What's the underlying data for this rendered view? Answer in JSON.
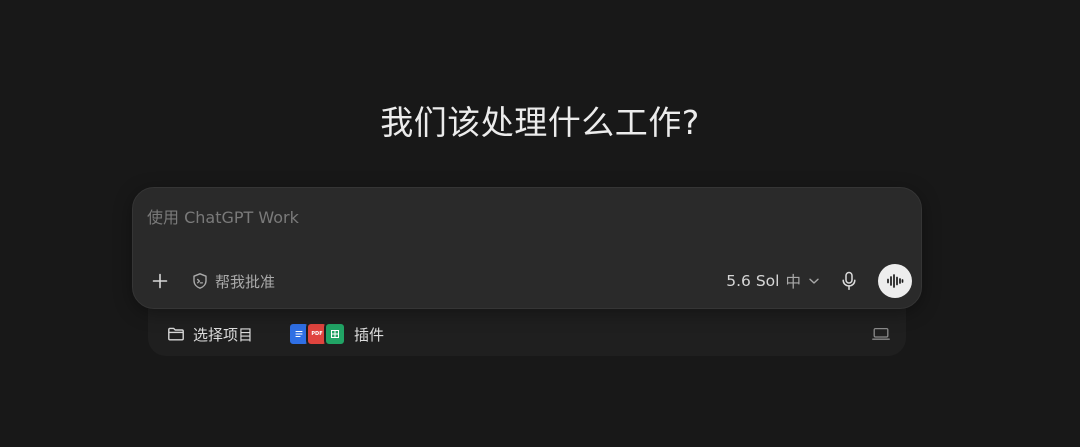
{
  "headline": "我们该处理什么工作?",
  "composer": {
    "placeholder": "使用 ChatGPT Work",
    "approve_label": "帮我批准",
    "model_name": "5.6 Sol",
    "model_effort": "中"
  },
  "toolbar": {
    "project_label": "选择项目",
    "plugins_label": "插件",
    "plugin_icons": [
      "docs-icon",
      "pdf-icon",
      "sheets-icon"
    ],
    "plugin_pdf_text": "PDF"
  },
  "colors": {
    "background": "#181818",
    "composer_bg": "#2a2a2a",
    "subbar_bg": "#1f1f1f",
    "docs_blue": "#2f6fe4",
    "pdf_red": "#e0443e",
    "sheets_green": "#21a465",
    "voice_button_bg": "#ededed"
  }
}
